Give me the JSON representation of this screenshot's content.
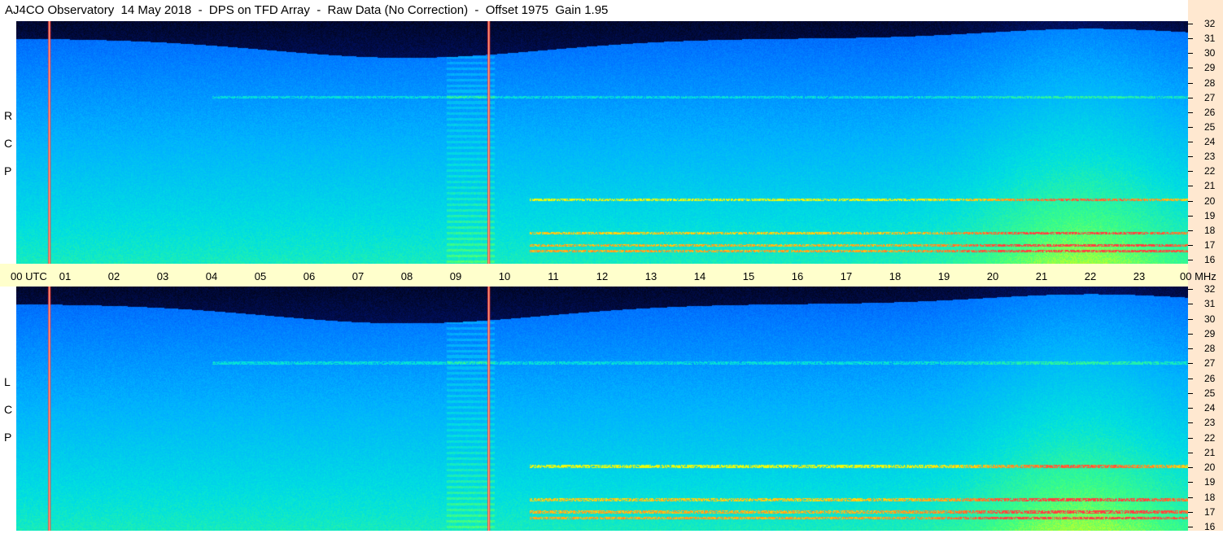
{
  "header": {
    "title": "AJ4CO Observatory  14 May 2018  -  DPS on TFD Array  -  Raw Data (No Correction)  -  Offset 1975  Gain 1.95"
  },
  "panels": {
    "rcp": {
      "label_letters": [
        "R",
        "C",
        "P"
      ]
    },
    "lcp": {
      "label_letters": [
        "L",
        "C",
        "P"
      ]
    }
  },
  "time_axis": {
    "labels": [
      "00  UTC",
      "01",
      "02",
      "03",
      "04",
      "05",
      "06",
      "07",
      "08",
      "09",
      "10",
      "11",
      "12",
      "13",
      "14",
      "15",
      "16",
      "17",
      "18",
      "19",
      "20",
      "21",
      "22",
      "23",
      "00 MHz"
    ]
  },
  "freq_axis": {
    "labels": [
      "32",
      "31",
      "30",
      "29",
      "28",
      "27",
      "26",
      "25",
      "24",
      "23",
      "22",
      "21",
      "20",
      "19",
      "18",
      "17",
      "16"
    ]
  },
  "chart_data": {
    "type": "heatmap",
    "title": "AJ4CO Observatory  14 May 2018  -  DPS on TFD Array  -  Raw Data (No Correction)  -  Offset 1975  Gain 1.95",
    "xlabel": "UTC",
    "ylabel": "MHz",
    "x_range": [
      0,
      24
    ],
    "y_range": [
      16,
      32
    ],
    "panels": [
      "RCP",
      "LCP"
    ],
    "colormap": [
      "#000000",
      "#001060",
      "#0030c0",
      "#0070ff",
      "#00b0ff",
      "#00e0e0",
      "#40ff80",
      "#ffff00",
      "#ff4040"
    ],
    "vertical_markers_utc": [
      0.67,
      9.67
    ],
    "horizontal_bands_mhz": [
      27,
      17.2,
      16.8,
      18,
      20.2
    ]
  }
}
